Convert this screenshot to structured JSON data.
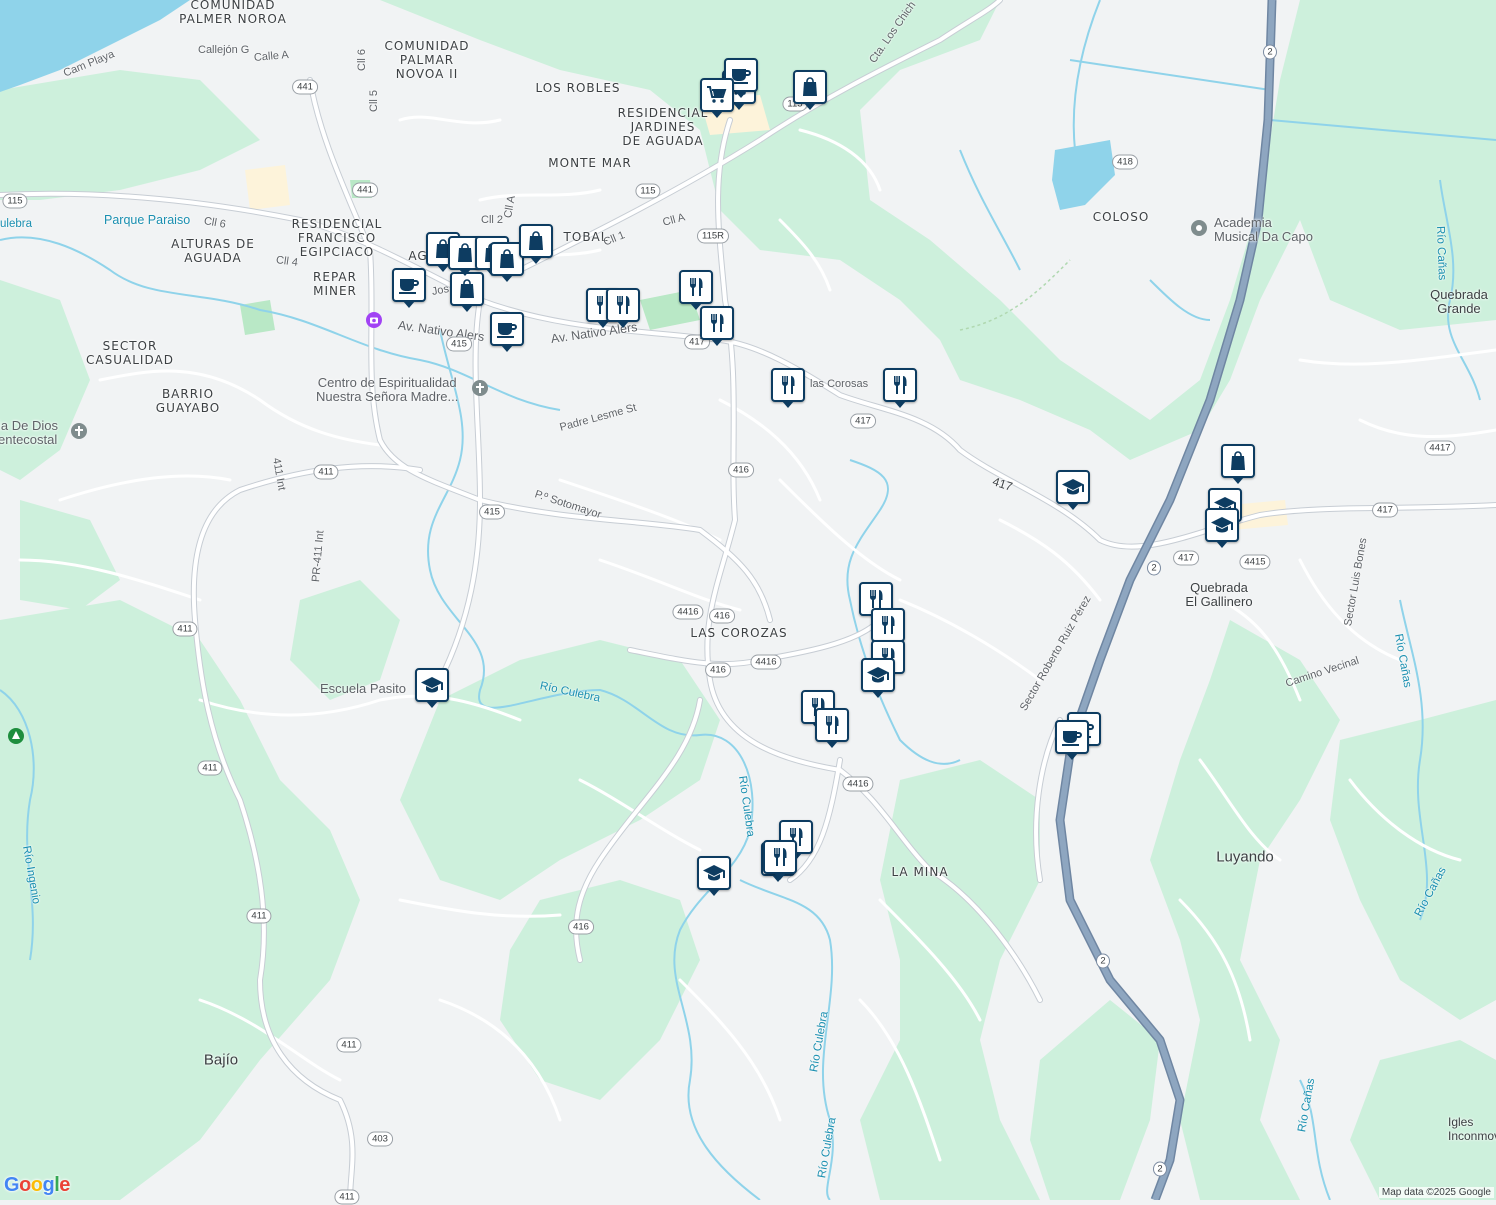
{
  "map": {
    "colors": {
      "land": "#f1f3f4",
      "forest": "#cdf0dc",
      "water": "#8fd3ea",
      "road": "#ffffff",
      "road_outline": "#c7cdd4",
      "highway": "#8ea6c0",
      "highway_outline": "#6f86a2",
      "pin": "#0d3c61"
    },
    "credit": "Map data ©2025 Google",
    "logo_text": "Google",
    "places": [
      {
        "id": "palmer-noroa",
        "text": "COMUNIDAD\nPALMER NOROA"
      },
      {
        "id": "palmar-novoa",
        "text": "COMUNIDAD\nPALMAR\nNOVOA II"
      },
      {
        "id": "los-robles",
        "text": "LOS ROBLES"
      },
      {
        "id": "jardines",
        "text": "RESIDENCIAL\nJARDINES\nDE AGUADA"
      },
      {
        "id": "monte-mar",
        "text": "MONTE MAR"
      },
      {
        "id": "res-francisco",
        "text": "RESIDENCIAL\nFRANCISCO\nEGIPCIACO"
      },
      {
        "id": "alturas",
        "text": "ALTURAS DE\nAGUADA"
      },
      {
        "id": "repar-miner",
        "text": "REPAR\nMINER"
      },
      {
        "id": "ag",
        "text": "AG"
      },
      {
        "id": "cristobal",
        "text": "TOBAL"
      },
      {
        "id": "sector-casualidad",
        "text": "SECTOR\nCASUALIDAD"
      },
      {
        "id": "barrio-guayabo",
        "text": "BARRIO\nGUAYABO"
      },
      {
        "id": "las-corozas",
        "text": "LAS COROZAS"
      },
      {
        "id": "la-mina",
        "text": "LA MINA"
      },
      {
        "id": "coloso",
        "text": "COLOSO"
      }
    ],
    "towns": [
      {
        "id": "luyando",
        "text": "Luyando"
      },
      {
        "id": "bajio",
        "text": "Bajío"
      },
      {
        "id": "quebrada-grande",
        "text": "Quebrada\nGrande"
      },
      {
        "id": "quebrada-gallinero",
        "text": "Quebrada\nEl Gallinero"
      },
      {
        "id": "igles",
        "text": "Igles\nInconmov"
      }
    ],
    "streets": [
      {
        "id": "cam-playa",
        "text": "Cam Playa"
      },
      {
        "id": "callejon-g",
        "text": "Callejón G"
      },
      {
        "id": "calle-a",
        "text": "Calle A"
      },
      {
        "id": "cll-6-v",
        "text": "Cll 6"
      },
      {
        "id": "cll-5",
        "text": "Cll 5"
      },
      {
        "id": "cll-6-h",
        "text": "Cll 6"
      },
      {
        "id": "cll-4",
        "text": "Cll 4"
      },
      {
        "id": "cll-2",
        "text": "Cll 2"
      },
      {
        "id": "cll-a-v",
        "text": "Cll A"
      },
      {
        "id": "cll-1",
        "text": "Cll 1"
      },
      {
        "id": "cll-a",
        "text": "Cll A"
      },
      {
        "id": "cta-chich",
        "text": "Cta. Los Chich"
      },
      {
        "id": "parque-paraiso",
        "text": "Parque Paraiso"
      },
      {
        "id": "av-nativo-1",
        "text": "Av. Nativo Alers"
      },
      {
        "id": "av-nativo-2",
        "text": "Av. Nativo Alers"
      },
      {
        "id": "las-corosas",
        "text": "las Corosas"
      },
      {
        "id": "padre-lesme",
        "text": "Padre Lesme St"
      },
      {
        "id": "sotomayor",
        "text": "P.º Sotomayor"
      },
      {
        "id": "int-411-a",
        "text": "411 Int"
      },
      {
        "id": "int-411-b",
        "text": "PR-411 Int"
      },
      {
        "id": "road-417",
        "text": "417"
      },
      {
        "id": "sector-roberto",
        "text": "Sector Roberto Ruiz Pérez"
      },
      {
        "id": "sector-luis",
        "text": "Sector Luis Bones"
      },
      {
        "id": "camino-vecinal",
        "text": "Camino Vecinal"
      },
      {
        "id": "jos",
        "text": "Jos"
      }
    ],
    "waters": [
      {
        "id": "culebra-nw",
        "text": "ulebra"
      },
      {
        "id": "rio-culebra-1",
        "text": "Río Culebra"
      },
      {
        "id": "rio-culebra-2",
        "text": "Río Culebra"
      },
      {
        "id": "rio-culebra-3",
        "text": "Río Culebra"
      },
      {
        "id": "rio-culebra-4",
        "text": "Río Culebra"
      },
      {
        "id": "rio-ingenio",
        "text": "Río Ingenio"
      },
      {
        "id": "rio-canas-1",
        "text": "Río Cañas"
      },
      {
        "id": "rio-canas-2",
        "text": "Río Cañas"
      },
      {
        "id": "rio-canas-3",
        "text": "Río Cañas"
      },
      {
        "id": "rio-canas-4",
        "text": "Río Cañas"
      }
    ],
    "shields": [
      "441",
      "115",
      "441",
      "115",
      "115R",
      "415",
      "417",
      "417",
      "411",
      "415",
      "416",
      "4416",
      "416",
      "416",
      "4416",
      "411",
      "4416",
      "411",
      "411",
      "416",
      "411",
      "403",
      "411",
      "418",
      "2",
      "2",
      "2",
      "2",
      "417",
      "4415",
      "4417",
      "417",
      "115"
    ],
    "pois": [
      {
        "id": "academia",
        "text": "Academia\nMusical Da Capo",
        "icon": "pin-icon",
        "color": "#7f8c8d"
      },
      {
        "id": "centro",
        "text": "Centro de Espiritualidad\nNuestra Señora Madre...",
        "icon": "cross-icon",
        "color": "#7f8c8d"
      },
      {
        "id": "iglesia",
        "text": "ia De Dios\nentecostal",
        "icon": "cross-icon",
        "color": "#7f8c8d"
      },
      {
        "id": "escuela",
        "text": "Escuela Pasito",
        "icon": "school-icon",
        "color": "#0d3c61"
      },
      {
        "id": "camera",
        "text": "",
        "icon": "camera-icon",
        "color": "#a142f4"
      },
      {
        "id": "park",
        "text": "",
        "icon": "park-icon",
        "color": "#1e8e3e"
      }
    ],
    "markers": [
      {
        "icon": "cart"
      },
      {
        "icon": "coffee"
      },
      {
        "icon": "bag"
      },
      {
        "icon": "cart"
      },
      {
        "icon": "coffee"
      },
      {
        "icon": "bag"
      },
      {
        "icon": "bag"
      },
      {
        "icon": "bag"
      },
      {
        "icon": "bag"
      },
      {
        "icon": "bag"
      },
      {
        "icon": "bag"
      },
      {
        "icon": "fork"
      },
      {
        "icon": "fork"
      },
      {
        "icon": "fork"
      },
      {
        "icon": "fork"
      },
      {
        "icon": "coffee"
      },
      {
        "icon": "fork"
      },
      {
        "icon": "fork"
      },
      {
        "icon": "school"
      },
      {
        "icon": "bag"
      },
      {
        "icon": "school"
      },
      {
        "icon": "school"
      },
      {
        "icon": "fork"
      },
      {
        "icon": "fork"
      },
      {
        "icon": "fork"
      },
      {
        "icon": "school"
      },
      {
        "icon": "fork"
      },
      {
        "icon": "fork"
      },
      {
        "icon": "fork"
      },
      {
        "icon": "coffee"
      },
      {
        "icon": "coffee"
      },
      {
        "icon": "fork"
      },
      {
        "icon": "fork"
      },
      {
        "icon": "school"
      },
      {
        "icon": "school"
      }
    ]
  }
}
